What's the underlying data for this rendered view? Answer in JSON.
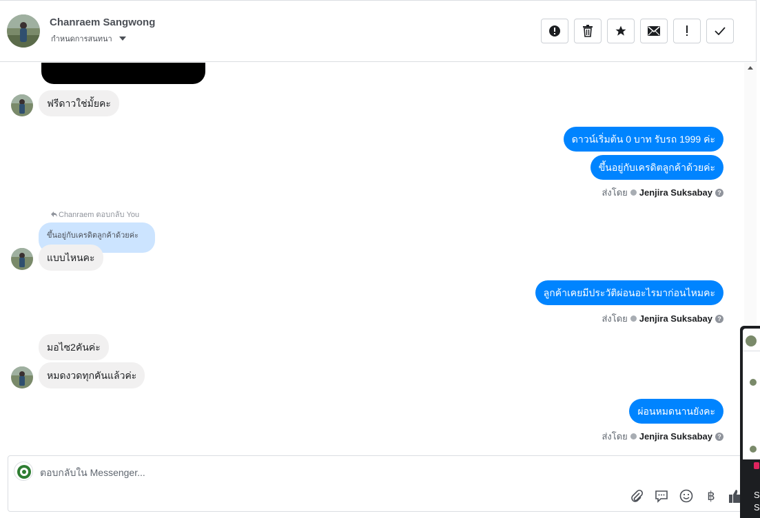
{
  "header": {
    "contact_name": "Chanraem Sangwong",
    "subtitle": "กำหนดการสนทนา",
    "toolbar": [
      {
        "name": "report-button",
        "icon": "alert-circle-icon"
      },
      {
        "name": "delete-button",
        "icon": "trash-icon"
      },
      {
        "name": "star-button",
        "icon": "star-icon"
      },
      {
        "name": "mark-unread-button",
        "icon": "envelope-icon"
      },
      {
        "name": "follow-up-button",
        "icon": "exclamation-icon"
      },
      {
        "name": "mark-done-button",
        "icon": "checkmark-icon"
      }
    ]
  },
  "thread": {
    "msg1_in": "ฟรีดาวใช่มั้ยคะ",
    "msg2_out": "ดาวน์เริ่มต้น 0 บาท รับรถ 1999 ค่ะ",
    "msg3_out": "ขึ้นอยู่กับเครดิตลูกค้าด้วยค่ะ",
    "sent_by_label": "ส่งโดย",
    "sender_name": "Jenjira Suksabay",
    "reply_meta": "Chanraem ตอบกลับ You",
    "reply_quote": "ขึ้นอยู่กับเครดิตลูกค้าด้วยค่ะ",
    "msg4_in": "แบบไหนคะ",
    "msg5_out": "ลูกค้าเคยมีประวัติผ่อนอะไรมาก่อนไหมคะ",
    "msg6_in": "มอไซ2คันค่ะ",
    "msg7_in": "หมดงวดทุกคันแล้วค่ะ",
    "msg8_out": "ผ่อนหมดนานยังคะ"
  },
  "composer": {
    "placeholder": "ตอบกลับใน Messenger...",
    "baht_symbol": "฿"
  },
  "side_panel": {
    "line1": "S",
    "line2": "S"
  },
  "colors": {
    "outgoing_bubble": "#0084ff",
    "incoming_bubble": "#f1f0f0",
    "reply_quote_bg": "#cce4ff",
    "like_icon": "#4b4f56"
  }
}
